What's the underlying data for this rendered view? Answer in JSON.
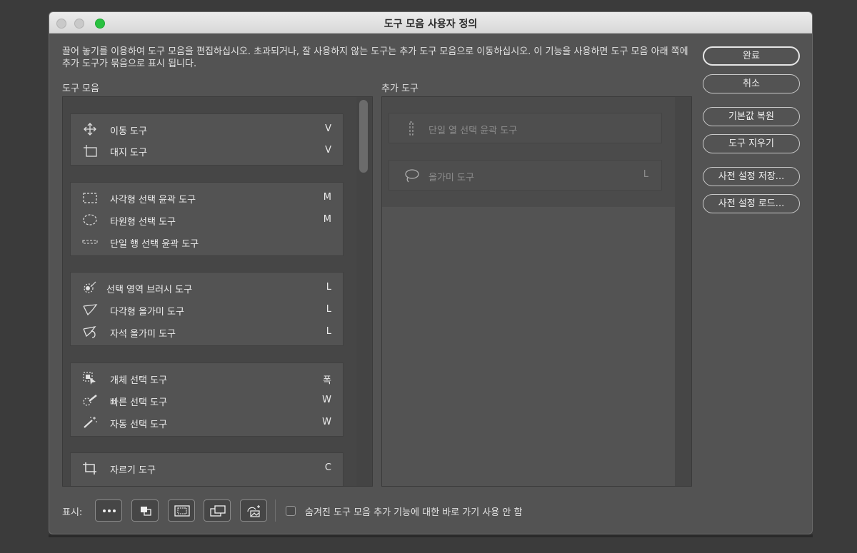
{
  "window": {
    "title": "도구 모음 사용자 정의"
  },
  "description": "끌어 놓기를 이용하여 도구 모음을 편집하십시오. 초과되거나, 잘 사용하지 않는 도구는 추가 도구 모음으로 이동하십시오. 이 기능을 사용하면 도구 모음 아래 쪽에 추가 도구가 묶음으로 표시 됩니다.",
  "toolbar_section": {
    "label": "도구 모음",
    "groups": [
      {
        "tools": [
          {
            "name": "이동 도구",
            "key": "V",
            "icon": "move-icon"
          },
          {
            "name": "대지 도구",
            "key": "V",
            "icon": "artboard-icon"
          }
        ]
      },
      {
        "tools": [
          {
            "name": "사각형 선택 윤곽 도구",
            "key": "M",
            "icon": "rect-marquee-icon"
          },
          {
            "name": "타원형 선택 도구",
            "key": "M",
            "icon": "ellipse-marquee-icon"
          },
          {
            "name": "단일 행 선택 윤곽 도구",
            "key": "",
            "icon": "single-row-marquee-icon"
          }
        ]
      },
      {
        "tools": [
          {
            "name": "선택 영역 브러시 도구",
            "key": "L",
            "icon": "selection-brush-icon"
          },
          {
            "name": "다각형 올가미 도구",
            "key": "L",
            "icon": "polygonal-lasso-icon"
          },
          {
            "name": "자석 올가미 도구",
            "key": "L",
            "icon": "magnetic-lasso-icon"
          }
        ]
      },
      {
        "tools": [
          {
            "name": "개체 선택 도구",
            "key": "폭",
            "icon": "object-selection-icon"
          },
          {
            "name": "빠른 선택 도구",
            "key": "W",
            "icon": "quick-selection-icon"
          },
          {
            "name": "자동 선택 도구",
            "key": "W",
            "icon": "magic-wand-icon"
          }
        ]
      },
      {
        "tools": [
          {
            "name": "자르기 도구",
            "key": "C",
            "icon": "crop-icon"
          }
        ]
      }
    ]
  },
  "extra_section": {
    "label": "추가 도구",
    "tools": [
      {
        "name": "단일 열 선택 윤곽 도구",
        "key": "",
        "icon": "single-column-marquee-icon"
      },
      {
        "name": "올가미 도구",
        "key": "L",
        "icon": "lasso-icon"
      }
    ]
  },
  "buttons": {
    "done": "완료",
    "cancel": "취소",
    "restore_defaults": "기본값 복원",
    "clear_tools": "도구 지우기",
    "save_preset": "사전 설정 저장...",
    "load_preset": "사전 설정 로드..."
  },
  "bottom": {
    "show_label": "표시:",
    "icons": [
      "more-icon",
      "foreground-background-icon",
      "quick-mask-icon",
      "screen-mode-icon",
      "edit-image-icon"
    ],
    "checkbox_label": "숨겨진 도구 모음 추가 기능에 대한 바로 가기 사용 안 함",
    "checkbox_checked": false
  }
}
